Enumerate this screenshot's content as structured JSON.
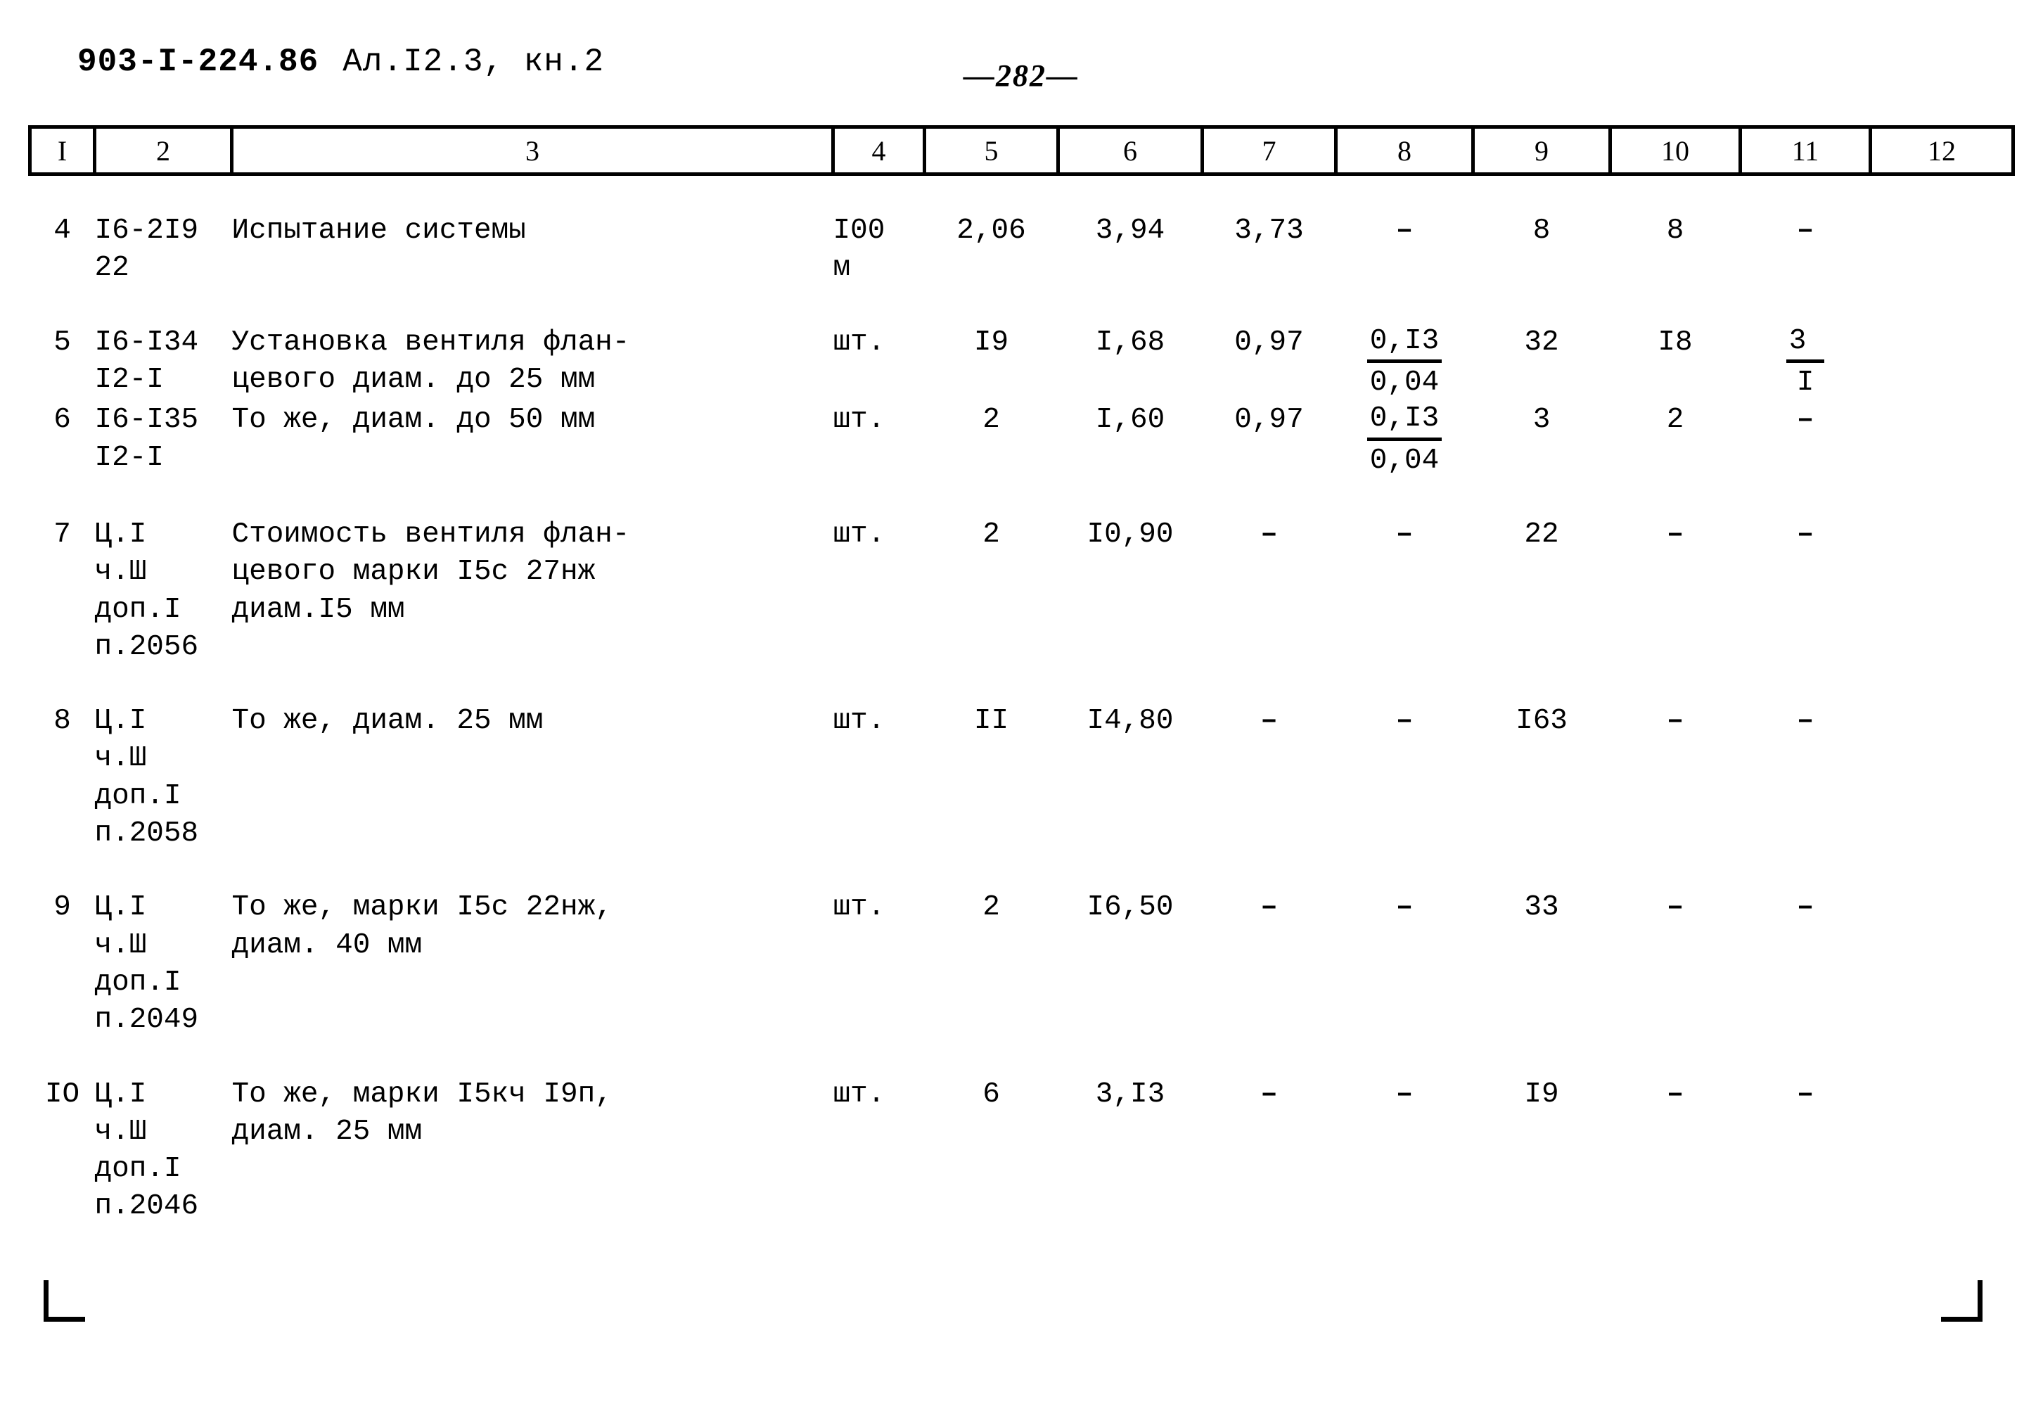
{
  "header": {
    "document_code": "903-I-224.86",
    "album": "Ал.I2.3, кн.2",
    "page_number": "—282—"
  },
  "table": {
    "column_headers": [
      "I",
      "2",
      "3",
      "4",
      "5",
      "6",
      "7",
      "8",
      "9",
      "10",
      "11",
      "12"
    ],
    "rows": [
      {
        "num": "4",
        "code": "I6-2I9\n22",
        "description": "Испытание системы",
        "unit": "I00\nм",
        "c5": "2,06",
        "c6": "3,94",
        "c7": "3,73",
        "c8": "–",
        "c9": "8",
        "c10": "8",
        "c11": "–",
        "c12": ""
      },
      {
        "num": "5",
        "code": "I6-I34\nI2-I",
        "description": "Установка вентиля флан-\nцевого диам. до 25 мм",
        "unit": "шт.",
        "c5": "I9",
        "c6": "I,68",
        "c7": "0,97",
        "c8_numerator": "0,I3",
        "c8_denominator": "0,04",
        "c9": "32",
        "c10": "I8",
        "c11_numerator": "3",
        "c11_denominator": "I",
        "c12": ""
      },
      {
        "num": "6",
        "code": "I6-I35\nI2-I",
        "description": "То же, диам. до 50 мм",
        "unit": "шт.",
        "c5": "2",
        "c6": "I,60",
        "c7": "0,97",
        "c8_numerator": "0,I3",
        "c8_denominator": "0,04",
        "c9": "3",
        "c10": "2",
        "c11": "–",
        "c12": ""
      },
      {
        "num": "7",
        "code": "Ц.I\nч.Ш\nдоп.I\nп.2056",
        "description": "Стоимость вентиля флан-\nцевого марки I5с 27нж\nдиам.I5 мм",
        "unit": "шт.",
        "c5": "2",
        "c6": "I0,90",
        "c7": "–",
        "c8": "–",
        "c9": "22",
        "c10": "–",
        "c11": "–",
        "c12": ""
      },
      {
        "num": "8",
        "code": "Ц.I\nч.Ш\nдоп.I\nп.2058",
        "description": "То же, диам. 25 мм",
        "unit": "шт.",
        "c5": "II",
        "c6": "I4,80",
        "c7": "–",
        "c8": "–",
        "c9": "I63",
        "c10": "–",
        "c11": "–",
        "c12": ""
      },
      {
        "num": "9",
        "code": "Ц.I\nч.Ш\nдоп.I\nп.2049",
        "description": "То же, марки I5с 22нж,\nдиам. 40 мм",
        "unit": "шт.",
        "c5": "2",
        "c6": "I6,50",
        "c7": "–",
        "c8": "–",
        "c9": "33",
        "c10": "–",
        "c11": "–",
        "c12": ""
      },
      {
        "num": "IO",
        "code": "Ц.I\nч.Ш\nдоп.I\nп.2046",
        "description": "То же, марки I5кч I9п,\nдиам. 25 мм",
        "unit": "шт.",
        "c5": "6",
        "c6": "3,I3",
        "c7": "–",
        "c8": "–",
        "c9": "I9",
        "c10": "–",
        "c11": "–",
        "c12": ""
      }
    ]
  }
}
